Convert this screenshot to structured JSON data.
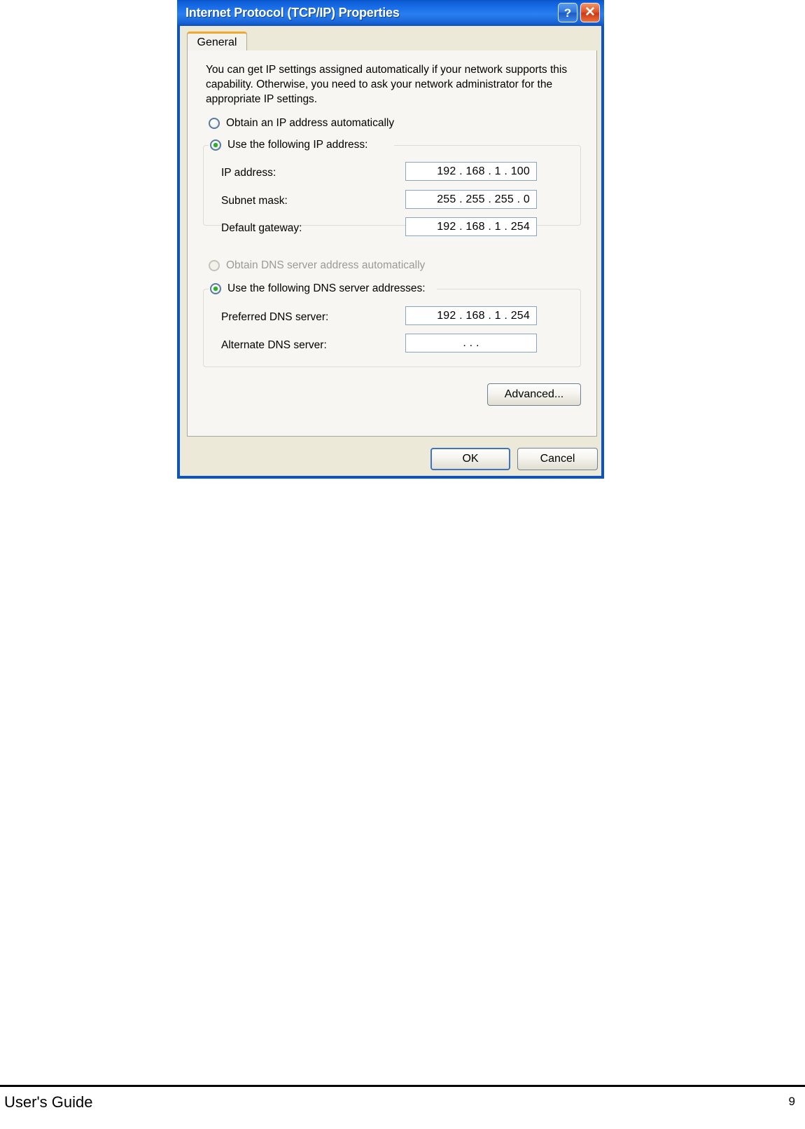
{
  "document": {
    "footer_left": "User's Guide",
    "page_number": "9"
  },
  "dialog": {
    "title": "Internet Protocol (TCP/IP) Properties",
    "titlebar_buttons": [
      {
        "name": "help-button",
        "glyph": "?"
      },
      {
        "name": "close-button",
        "glyph": "✕"
      }
    ],
    "tabs": [
      {
        "label": "General",
        "selected": true
      }
    ],
    "description": "You can get IP settings assigned automatically if your network supports this capability. Otherwise, you need to ask your network administrator for the appropriate IP settings.",
    "ip_section": {
      "auto_option_label": "Obtain an IP address automatically",
      "auto_option_selected": false,
      "manual_option_label": "Use the following IP address:",
      "manual_option_selected": true,
      "fields": [
        {
          "label": "IP address:",
          "value": "192 . 168 .  1   . 100"
        },
        {
          "label": "Subnet mask:",
          "value": "255 . 255 . 255 .   0"
        },
        {
          "label": "Default gateway:",
          "value": "192 . 168 .  1   . 254"
        }
      ]
    },
    "dns_section": {
      "auto_option_label": "Obtain DNS server address automatically",
      "auto_option_selected": false,
      "auto_option_disabled": true,
      "manual_option_label": "Use the following DNS server addresses:",
      "manual_option_selected": true,
      "fields": [
        {
          "label": "Preferred DNS server:",
          "value": "192 . 168 .  1   . 254"
        },
        {
          "label": "Alternate DNS server:",
          "value": ".         .         ."
        }
      ]
    },
    "advanced_button_label": "Advanced...",
    "ok_button_label": "OK",
    "cancel_button_label": "Cancel"
  },
  "colors": {
    "titlebar_blue": "#1a6ee8",
    "window_chrome": "#ece9d8",
    "panel": "#f7f6f2",
    "tab_accent_orange": "#f0a830",
    "radio_dot_green": "#2ab02a",
    "close_button_red": "#e2562a",
    "input_border": "#8aa5c0",
    "default_button_focus": "#3f73c4"
  }
}
